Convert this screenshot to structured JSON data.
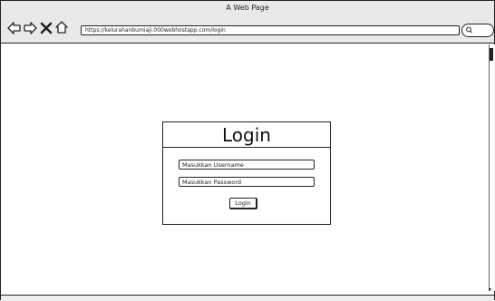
{
  "window": {
    "title": "A Web Page",
    "address": "https://kelurahanbumiaji.000webhostapp.com/login"
  },
  "nav": {
    "back_icon": "back-arrow-icon",
    "forward_icon": "forward-arrow-icon",
    "close_icon": "close-x-icon",
    "home_icon": "home-icon",
    "search_icon": "search-icon"
  },
  "login": {
    "title": "Login",
    "username_placeholder": "Masukkan Username",
    "password_placeholder": "Masukkan Password",
    "button_label": "Login"
  }
}
